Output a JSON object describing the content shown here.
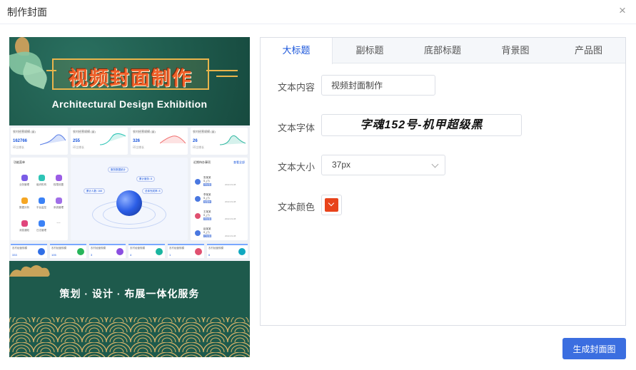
{
  "dialog": {
    "title": "制作封面",
    "close_icon": "×"
  },
  "preview": {
    "title": "视频封面制作",
    "subtitle": "Architectural Design Exhibition",
    "slogan": "策划 · 设计 · 布展一体化服务",
    "dashboard": {
      "stat_cards": [
        {
          "label": "农村经营规模 (亩)",
          "value": "162766",
          "sub": "环比增长"
        },
        {
          "label": "农村经营规模 (亩)",
          "value": "255",
          "sub": "环比增长"
        },
        {
          "label": "农村经营规模 (亩)",
          "value": "326",
          "sub": "环比增长"
        },
        {
          "label": "农村经营规模 (亩)",
          "value": "26",
          "sub": "环比增长"
        }
      ],
      "menu_panel_title": "功能菜单",
      "menu_items": [
        "业务管理",
        "组织机构",
        "权限设置",
        "数据分析",
        "平台监控",
        "系统管理",
        "消息通知",
        "日志管理",
        "…"
      ],
      "hub_labels": [
        "服务数据统计",
        "累计服务: 8",
        "累计人数: 168",
        "总体完成率: 8"
      ],
      "task_panel_title": "近期待办事项",
      "task_panel_link": "查看全部",
      "tasks": [
        {
          "name": "张某某",
          "detail": "S_(?)",
          "tag": "待处理",
          "time": "2022-03-08"
        },
        {
          "name": "李某某",
          "detail": "S_(?)",
          "tag": "处理中",
          "time": "2022-03-08"
        },
        {
          "name": "王某某",
          "detail": "S_(?)",
          "tag": "待处理",
          "time": "2022-03-08"
        },
        {
          "name": "赵某某",
          "detail": "S_(?)",
          "tag": "已处理",
          "time": "2022-03-08"
        }
      ],
      "bottom_cards": [
        {
          "label": "农村经营规模",
          "value": "333",
          "color": "#2f6ee6"
        },
        {
          "label": "农村经营规模",
          "value": "105",
          "color": "#27b55a"
        },
        {
          "label": "农村经营规模",
          "value": "3",
          "color": "#8a4ee0"
        },
        {
          "label": "农村经营规模",
          "value": "4",
          "color": "#19b5a0"
        },
        {
          "label": "农村经营规模",
          "value": "1",
          "color": "#e05070"
        },
        {
          "label": "农村经营规模",
          "value": "6",
          "color": "#10a8c0"
        }
      ]
    },
    "colors": {
      "background": "#1e5a4c",
      "title_orange": "#f0602a",
      "gold": "#e9b44c"
    }
  },
  "tabs": [
    {
      "label": "大标题",
      "active": true
    },
    {
      "label": "副标题",
      "active": false
    },
    {
      "label": "底部标题",
      "active": false
    },
    {
      "label": "背景图",
      "active": false
    },
    {
      "label": "产品图",
      "active": false
    }
  ],
  "form": {
    "text_content_label": "文本内容",
    "text_content_value": "视频封面制作",
    "font_label": "文本字体",
    "font_value": "字魂152号-机甲超级黑",
    "size_label": "文本大小",
    "size_value": "37px",
    "color_label": "文本颜色",
    "color_value": "#e8431b"
  },
  "actions": {
    "generate_label": "生成封面图",
    "primary_color": "#3b6ee0"
  }
}
